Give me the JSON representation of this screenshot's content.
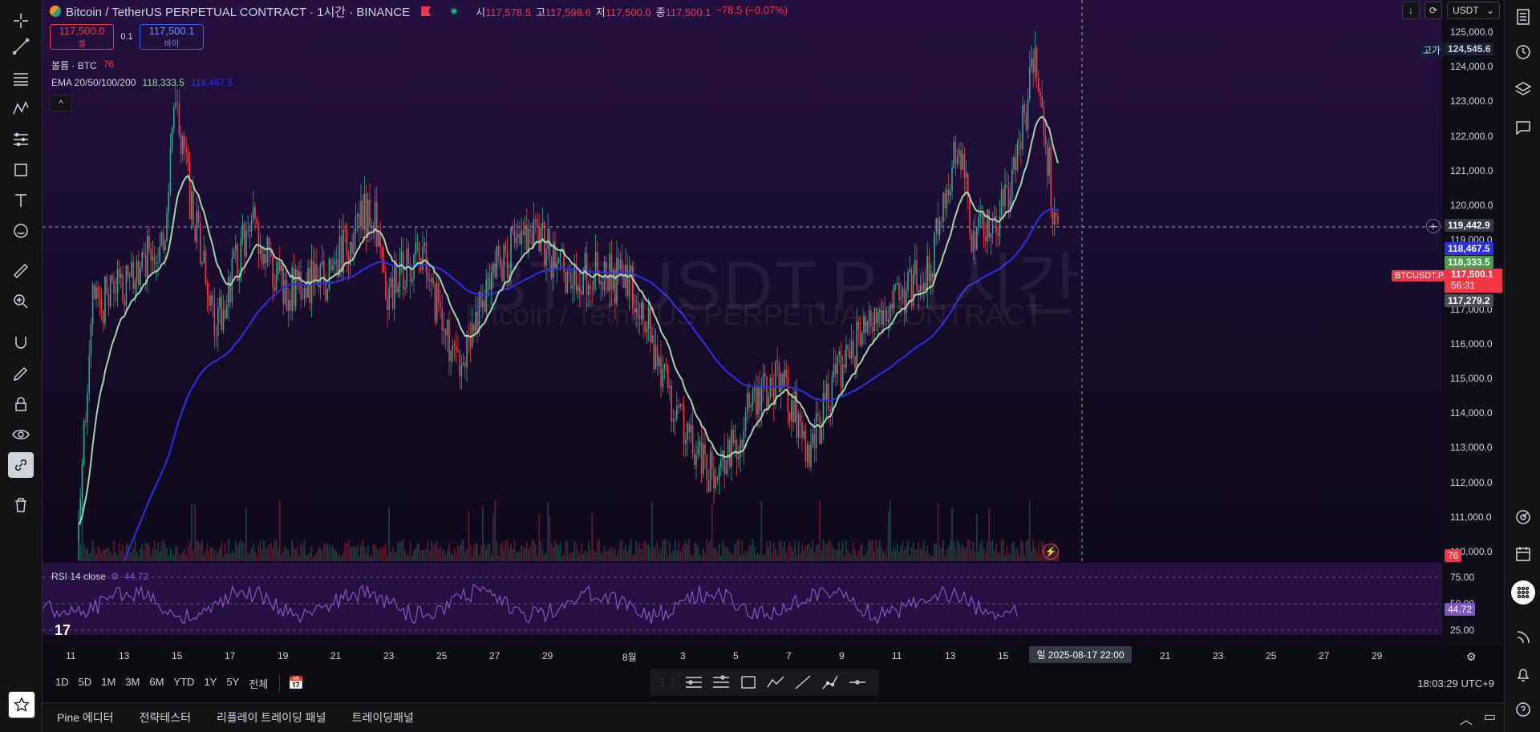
{
  "header": {
    "title": "Bitcoin / TetherUS PERPETUAL CONTRACT · 1시간 · BINANCE",
    "ohlc_open_label": "시",
    "ohlc_open": "117,578.5",
    "ohlc_high_label": "고",
    "ohlc_high": "117,598.6",
    "ohlc_low_label": "저",
    "ohlc_low": "117,500.0",
    "ohlc_close_label": "종",
    "ohlc_close": "117,500.1",
    "ohlc_change": "−78.5 (−0.07%)"
  },
  "trade": {
    "sell_price": "117,500.0",
    "sell_label": "셀",
    "qty": "0.1",
    "buy_price": "117,500.1",
    "buy_label": "바이"
  },
  "indicators": {
    "volume_label": "볼륨 · BTC",
    "volume_value": "76",
    "ema_label": "EMA 20/50/100/200",
    "ema_value1": "118,333.5",
    "ema_value2": "118,467.5",
    "collapse": "^"
  },
  "watermark": {
    "symbol": "BTCUSDT.P, 1시간",
    "name": "Bitcoin / TetherUS PERPETUAL CONTRACT"
  },
  "controls": {
    "currency": "USDT",
    "download_icon": "download-icon",
    "refresh_icon": "refresh-icon"
  },
  "price_scale": {
    "labels": [
      "125,000.0",
      "124,000.0",
      "123,000.0",
      "122,000.0",
      "121,000.0",
      "120,000.0",
      "119,000.0",
      "118,000.0",
      "117,000.0",
      "116,000.0",
      "115,000.0",
      "114,000.0",
      "113,000.0",
      "112,000.0",
      "111,000.0",
      "110,000.0"
    ],
    "high_tag_label": "고가",
    "high_tag_value": "124,545.6",
    "crosshair_price": "119,442.9",
    "ema200_tag": "118,467.5",
    "ema50_tag": "118,333.5",
    "symbol_tag": "BTCUSDT.P",
    "last_price": "117,500.1",
    "countdown": "56:31",
    "low_tag": "117,279.2",
    "volume_tag": "76"
  },
  "rsi": {
    "label": "RSI 14 close",
    "value": "44.72",
    "levels": [
      "75.00",
      "50.00",
      "25.00"
    ]
  },
  "time_axis": {
    "labels": [
      {
        "text": "11"
      },
      {
        "text": "13"
      },
      {
        "text": "15"
      },
      {
        "text": "17"
      },
      {
        "text": "19"
      },
      {
        "text": "21"
      },
      {
        "text": "23"
      },
      {
        "text": "25"
      },
      {
        "text": "27"
      },
      {
        "text": "29"
      },
      {
        "text": "8월"
      },
      {
        "text": "3"
      },
      {
        "text": "5"
      },
      {
        "text": "7"
      },
      {
        "text": "9"
      },
      {
        "text": "11"
      },
      {
        "text": "13"
      },
      {
        "text": "15"
      },
      {
        "text": "21"
      },
      {
        "text": "23"
      },
      {
        "text": "25"
      },
      {
        "text": "27"
      },
      {
        "text": "29"
      }
    ],
    "crosshair_date": "일 2025-08-17   22:00"
  },
  "range_bar": {
    "buttons": [
      "1D",
      "5D",
      "1M",
      "3M",
      "6M",
      "YTD",
      "1Y",
      "5Y",
      "전체"
    ],
    "clock": "18:03:29 UTC+9"
  },
  "bottom_tabs": [
    "Pine 에디터",
    "전략테스터",
    "리플레이 트레이딩 패널",
    "트레이딩패널"
  ],
  "colors": {
    "ema_green": "#a5d6a7",
    "ema_blue": "#2b30e8",
    "rsi_purple": "#7e57c2",
    "down_red": "#f23645",
    "up_green": "#22ab94"
  }
}
